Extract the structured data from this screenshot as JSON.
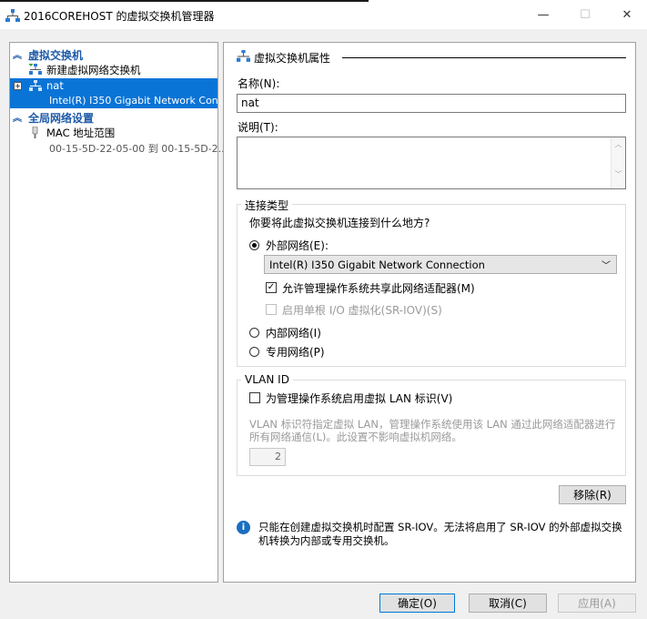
{
  "window": {
    "title": "2016COREHOST 的虚拟交换机管理器",
    "min_glyph": "—",
    "max_glyph": "☐",
    "close_glyph": "✕"
  },
  "tree": {
    "section1_label": "虚拟交换机",
    "new_switch_label": "新建虚拟网络交换机",
    "nat_label": "nat",
    "nat_sub": "Intel(R) I350 Gigabit Network Con...",
    "section2_label": "全局网络设置",
    "mac_label": "MAC 地址范围",
    "mac_sub": "00-15-5D-22-05-00 到 00-15-5D-2..."
  },
  "props": {
    "section_title": "虚拟交换机属性",
    "name_label": "名称(N):",
    "name_value": "nat",
    "notes_label": "说明(T):",
    "notes_value": "",
    "conn_group_title": "连接类型",
    "conn_question": "你要将此虚拟交换机连接到什么地方?",
    "external_label": "外部网络(E):",
    "adapter_selected": "Intel(R) I350 Gigabit Network Connection",
    "allow_mgmt_label": "允许管理操作系统共享此网络适配器(M)",
    "allow_mgmt_checked": true,
    "sriov_label": "启用单根 I/O 虚拟化(SR-IOV)(S)",
    "internal_label": "内部网络(I)",
    "private_label": "专用网络(P)",
    "connection_type": "external",
    "vlan_group_title": "VLAN ID",
    "vlan_enable_label": "为管理操作系统启用虚拟 LAN 标识(V)",
    "vlan_desc": "VLAN 标识符指定虚拟 LAN，管理操作系统使用该 LAN 通过此网络适配器进行所有网络通信(L)。此设置不影响虚拟机网络。",
    "vlan_value": "2",
    "remove_button": "移除(R)",
    "info_text": "只能在创建虚拟交换机时配置 SR-IOV。无法将启用了 SR-IOV 的外部虚拟交换机转换为内部或专用交换机。"
  },
  "footer": {
    "ok": "确定(O)",
    "cancel": "取消(C)",
    "apply": "应用(A)"
  },
  "icons": {
    "title": "network-switch-icon",
    "new_switch": "add-switch-icon",
    "nat": "network-switch-icon",
    "mac": "mac-address-icon",
    "info": "info-icon"
  },
  "colors": {
    "selection": "#0a74d6",
    "section_header": "#1e5aa8",
    "default_button_border": "#0078d7"
  }
}
